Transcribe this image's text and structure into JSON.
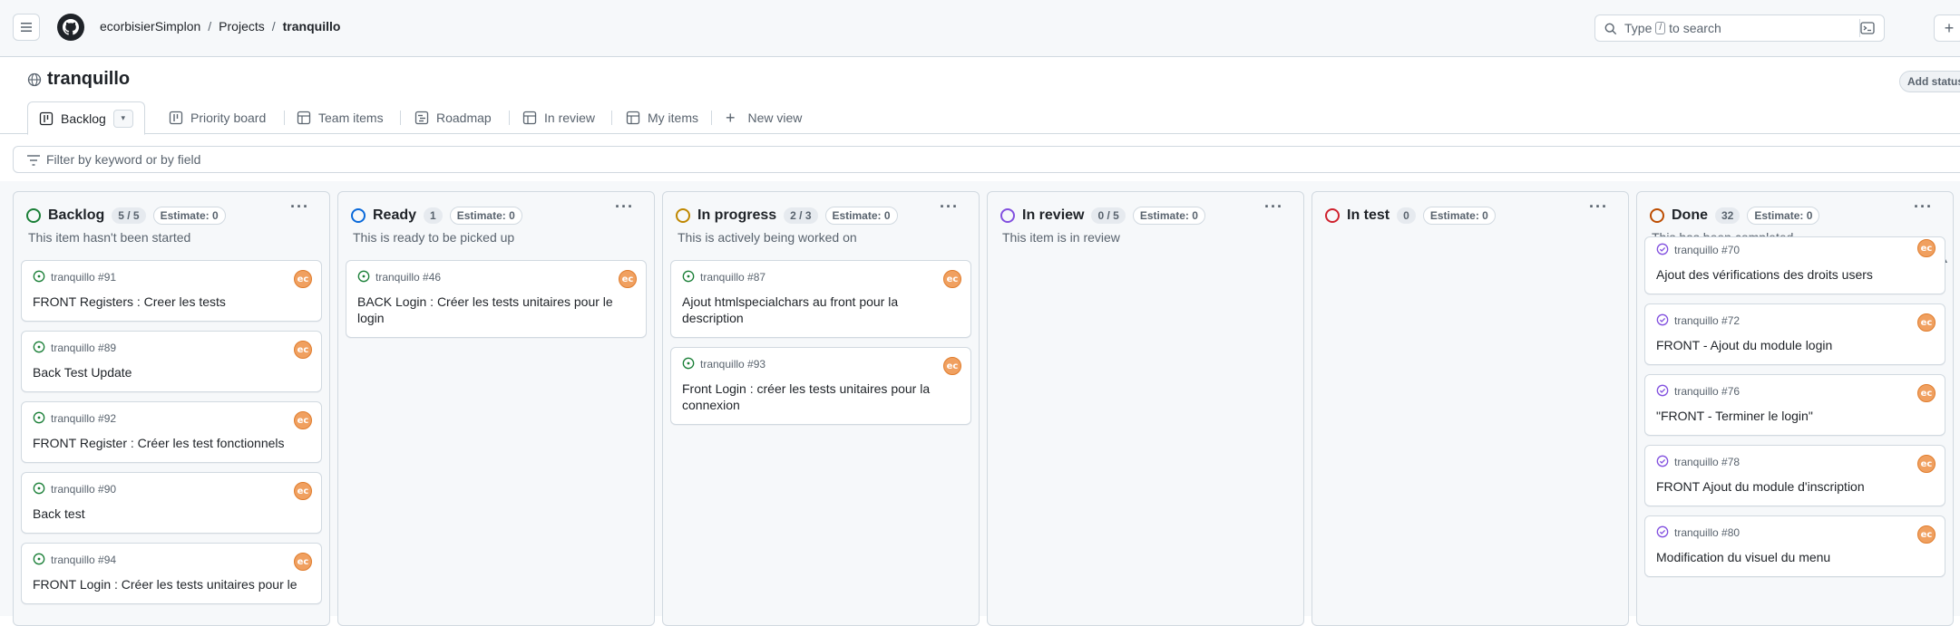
{
  "header": {
    "breadcrumb": [
      "ecorbisierSimplon",
      "Projects",
      "tranquillo"
    ],
    "search_prefix": "Type",
    "search_key": "/",
    "search_suffix": "to search"
  },
  "project": {
    "title": "tranquillo",
    "add_status": "Add status"
  },
  "tabs": [
    {
      "label": "Backlog",
      "icon": "board-icon"
    },
    {
      "label": "Priority board",
      "icon": "board-icon"
    },
    {
      "label": "Team items",
      "icon": "table-icon"
    },
    {
      "label": "Roadmap",
      "icon": "roadmap-icon"
    },
    {
      "label": "In review",
      "icon": "table-icon"
    },
    {
      "label": "My items",
      "icon": "table-icon"
    },
    {
      "label": "New view",
      "icon": "plus-icon"
    }
  ],
  "filter_placeholder": "Filter by keyword or by field",
  "colors": {
    "open": "#1a7f37",
    "done": "#8250df",
    "backlog": "#1a7f37",
    "ready": "#0969da",
    "progress": "#bf8700",
    "review": "#8250df",
    "test": "#cf222e",
    "donecol": "#bc4c00"
  },
  "columns": [
    {
      "title": "Backlog",
      "count": "5 / 5",
      "estimate": "Estimate: 0",
      "description": "This item hasn't been started",
      "cards": [
        {
          "ref": "tranquillo #91",
          "title": "FRONT Registers : Creer les tests"
        },
        {
          "ref": "tranquillo #89",
          "title": "Back Test Update"
        },
        {
          "ref": "tranquillo #92",
          "title": "FRONT Register : Créer les test fonctionnels"
        },
        {
          "ref": "tranquillo #90",
          "title": "Back test"
        },
        {
          "ref": "tranquillo #94",
          "title": "FRONT Login : Créer les tests unitaires pour le"
        }
      ]
    },
    {
      "title": "Ready",
      "count": "1",
      "estimate": "Estimate: 0",
      "description": "This is ready to be picked up",
      "cards": [
        {
          "ref": "tranquillo #46",
          "title": "BACK Login : Créer les tests unitaires pour le login"
        }
      ]
    },
    {
      "title": "In progress",
      "count": "2 / 3",
      "estimate": "Estimate: 0",
      "description": "This is actively being worked on",
      "cards": [
        {
          "ref": "tranquillo #87",
          "title": "Ajout htmlspecialchars au front pour la description"
        },
        {
          "ref": "tranquillo #93",
          "title": "Front Login : créer les tests unitaires pour la connexion"
        }
      ]
    },
    {
      "title": "In review",
      "count": "0 / 5",
      "estimate": "Estimate: 0",
      "description": "This item is in review",
      "cards": []
    },
    {
      "title": "In test",
      "count": "0",
      "estimate": "Estimate: 0",
      "description": "",
      "cards": []
    },
    {
      "title": "Done",
      "count": "32",
      "estimate": "Estimate: 0",
      "description": "This has been completed",
      "cards": [
        {
          "ref": "tranquillo #70",
          "title": "Ajout des vérifications des droits users"
        },
        {
          "ref": "tranquillo #72",
          "title": "FRONT - Ajout du module login"
        },
        {
          "ref": "tranquillo #76",
          "title": "\"FRONT - Terminer le login\""
        },
        {
          "ref": "tranquillo #78",
          "title": "FRONT Ajout du module d'inscription"
        },
        {
          "ref": "tranquillo #80",
          "title": "Modification du visuel du menu"
        }
      ]
    }
  ],
  "avatar_initials": "ec"
}
